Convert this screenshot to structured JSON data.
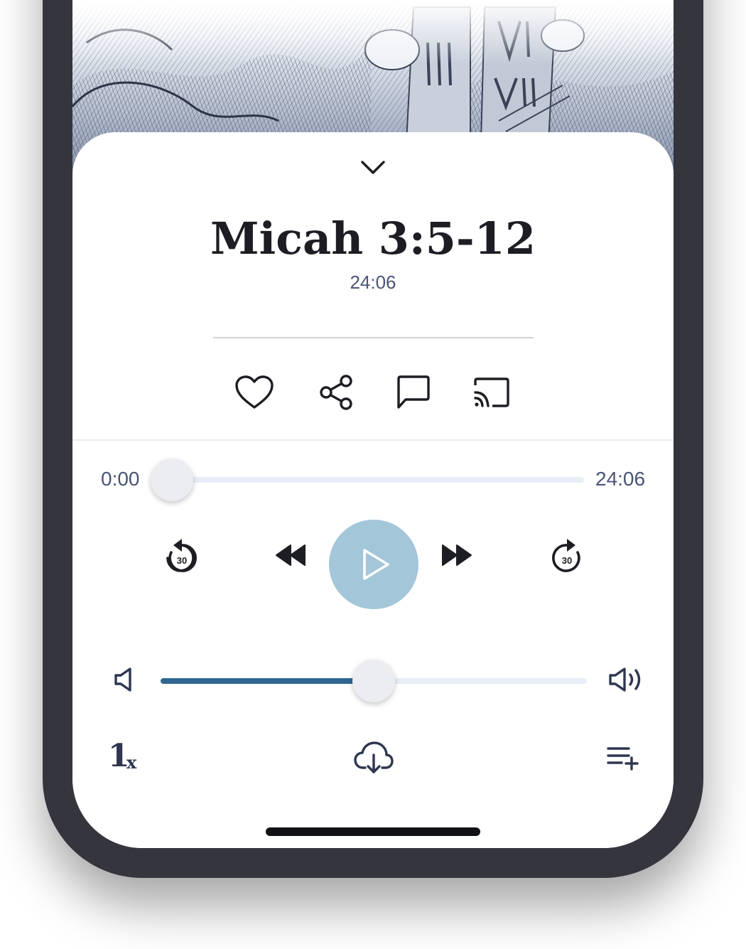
{
  "episode": {
    "title": "Micah 3:5-12",
    "duration": "24:06"
  },
  "actions": {
    "items": [
      {
        "name": "favorite",
        "icon": "heart-icon"
      },
      {
        "name": "share",
        "icon": "share-icon"
      },
      {
        "name": "comment",
        "icon": "comment-icon"
      },
      {
        "name": "cast",
        "icon": "cast-icon"
      }
    ]
  },
  "progress": {
    "elapsed_label": "0:00",
    "total_label": "24:06",
    "fraction": 0.0
  },
  "transport": {
    "skip_back_seconds": "30",
    "skip_forward_seconds": "30"
  },
  "volume": {
    "level": 0.5
  },
  "bottom_bar": {
    "speed_number": "1",
    "speed_suffix": "x",
    "download_icon": "cloud-download-icon",
    "queue_icon": "add-to-queue-icon"
  },
  "colors": {
    "accent": "#2f6792",
    "play_button": "#a3c6d9",
    "text_primary": "#1d1d24",
    "text_secondary": "#4a5478",
    "frame": "#35353e"
  }
}
